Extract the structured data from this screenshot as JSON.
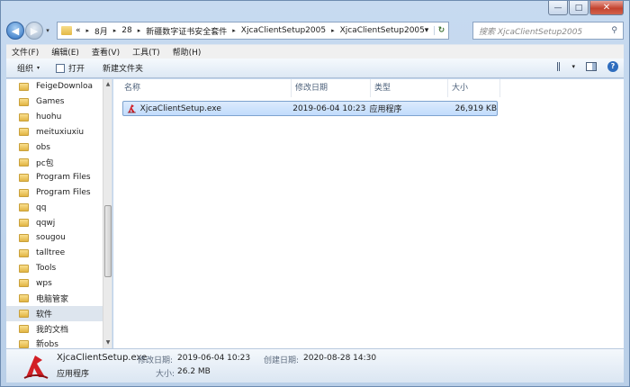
{
  "window": {
    "minimize_glyph": "—",
    "maximize_glyph": "□",
    "close_glyph": "✕"
  },
  "nav": {
    "back_glyph": "◀",
    "forward_glyph": "▶",
    "dropdown_glyph": "▾"
  },
  "address": {
    "overflow": "«",
    "crumbs": [
      "8月",
      "28",
      "新疆数字证书安全套件",
      "XjcaClientSetup2005",
      "XjcaClientSetup2005"
    ],
    "separator": "▸",
    "refresh_glyph": "↻"
  },
  "search": {
    "placeholder": "搜索 XjcaClientSetup2005",
    "icon": "search-icon"
  },
  "menu": [
    "文件(F)",
    "编辑(E)",
    "查看(V)",
    "工具(T)",
    "帮助(H)"
  ],
  "toolbar": {
    "organize": "组织",
    "open": "打开",
    "new_folder": "新建文件夹",
    "help": "?"
  },
  "nav_pane": {
    "items": [
      {
        "label": "FeigeDownloa"
      },
      {
        "label": "Games"
      },
      {
        "label": "huohu"
      },
      {
        "label": "meituxiuxiu"
      },
      {
        "label": "obs"
      },
      {
        "label": "pc包"
      },
      {
        "label": "Program Files"
      },
      {
        "label": "Program Files"
      },
      {
        "label": "qq"
      },
      {
        "label": "qqwj"
      },
      {
        "label": "sougou"
      },
      {
        "label": "talltree"
      },
      {
        "label": "Tools"
      },
      {
        "label": "wps"
      },
      {
        "label": "电脑管家"
      },
      {
        "label": "软件",
        "selected": true
      },
      {
        "label": "我的文档"
      },
      {
        "label": "新obs"
      }
    ]
  },
  "columns": [
    "名称",
    "修改日期",
    "类型",
    "大小"
  ],
  "files": [
    {
      "name": "XjcaClientSetup.exe",
      "modified": "2019-06-04 10:23",
      "type": "应用程序",
      "size": "26,919 KB"
    }
  ],
  "details": {
    "name": "XjcaClientSetup.exe",
    "type": "应用程序",
    "modified_label": "修改日期:",
    "modified": "2019-06-04 10:23",
    "created_label": "创建日期:",
    "created": "2020-08-28 14:30",
    "size_label": "大小:",
    "size": "26.2 MB"
  },
  "colors": {
    "selection": "#c1dcfc",
    "accent": "#2f6dbe",
    "app_icon_red": "#d21f25"
  }
}
